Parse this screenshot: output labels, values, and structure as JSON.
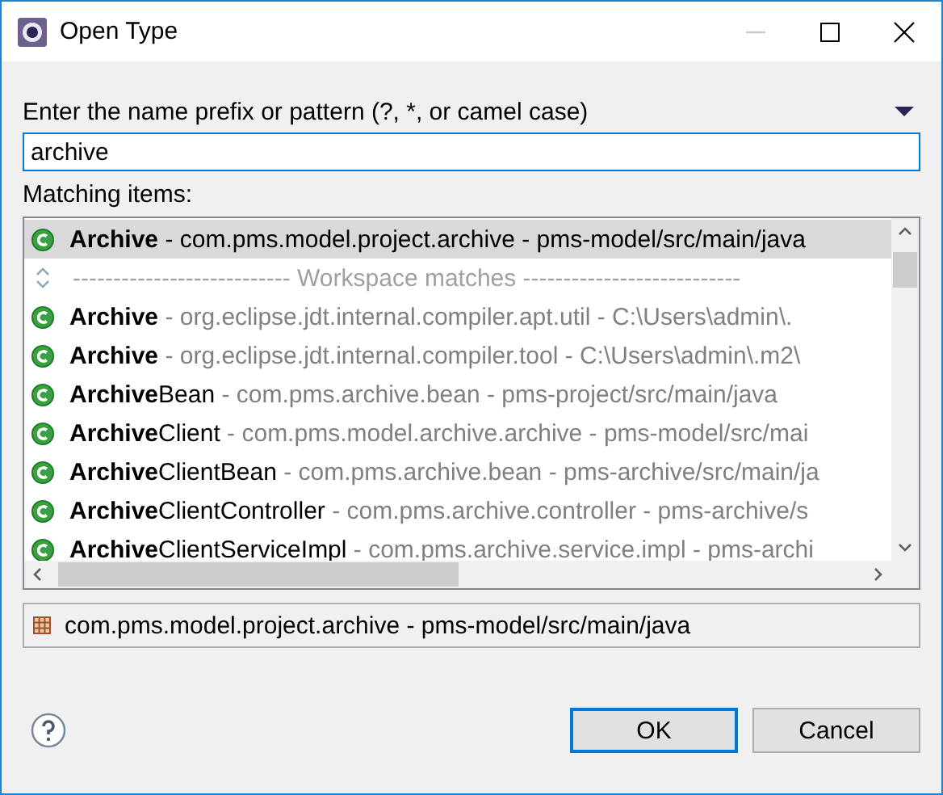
{
  "window": {
    "title": "Open Type"
  },
  "pattern": {
    "label": "Enter the name prefix or pattern (?, *, or camel case)",
    "value": "archive"
  },
  "matching_label": "Matching items:",
  "items": [
    {
      "kind": "type",
      "match": "Archive",
      "detail": " - com.pms.model.project.archive - pms-model/src/main/java",
      "selected": true
    },
    {
      "kind": "separator",
      "text": "--------------------------- Workspace matches ---------------------------"
    },
    {
      "kind": "type",
      "match": "Archive",
      "detail": " - org.eclipse.jdt.internal.compiler.apt.util - C:\\Users\\admin\\.",
      "selected": false
    },
    {
      "kind": "type",
      "match": "Archive",
      "detail": " - org.eclipse.jdt.internal.compiler.tool - C:\\Users\\admin\\.m2\\",
      "selected": false
    },
    {
      "kind": "type",
      "match": "Archive",
      "rest": "Bean",
      "detail": " - com.pms.archive.bean - pms-project/src/main/java",
      "selected": false
    },
    {
      "kind": "type",
      "match": "Archive",
      "rest": "Client",
      "detail": " - com.pms.model.archive.archive - pms-model/src/mai",
      "selected": false
    },
    {
      "kind": "type",
      "match": "Archive",
      "rest": "ClientBean",
      "detail": " - com.pms.archive.bean - pms-archive/src/main/ja",
      "selected": false
    },
    {
      "kind": "type",
      "match": "Archive",
      "rest": "ClientController",
      "detail": " - com.pms.archive.controller - pms-archive/s",
      "selected": false
    },
    {
      "kind": "type",
      "match": "Archive",
      "rest": "ClientServiceImpl",
      "detail": " - com.pms.archive.service.impl - pms-archi",
      "selected": false
    }
  ],
  "status": "com.pms.model.project.archive - pms-model/src/main/java",
  "buttons": [
    {
      "label": "OK",
      "default": true
    },
    {
      "label": "Cancel",
      "default": false
    }
  ]
}
